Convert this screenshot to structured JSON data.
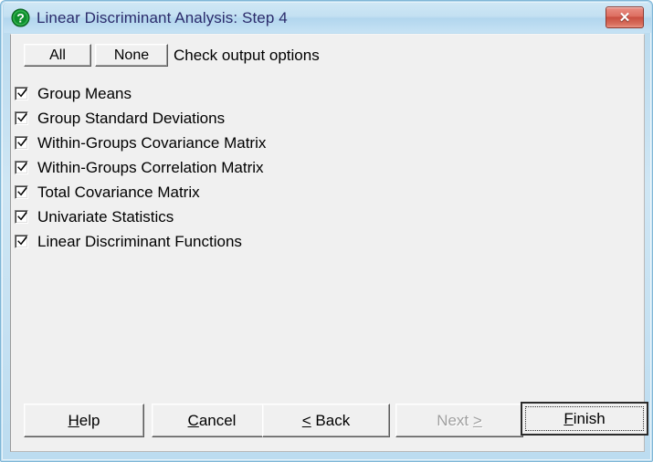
{
  "window": {
    "title": "Linear Discriminant Analysis: Step 4",
    "title_icon": "question-mark-icon",
    "close_label": "✕",
    "accent_title_color": "#2b2b6b",
    "close_button_color": "#c94e40",
    "frame_color": "#7fb6d6",
    "client_background": "#f0f0f0"
  },
  "toolbar": {
    "all_label": "All",
    "none_label": "None",
    "instruction": "Check output options"
  },
  "options": [
    {
      "label": "Group Means",
      "checked": true
    },
    {
      "label": "Group Standard Deviations",
      "checked": true
    },
    {
      "label": "Within-Groups Covariance Matrix",
      "checked": true
    },
    {
      "label": "Within-Groups Correlation Matrix",
      "checked": true
    },
    {
      "label": "Total Covariance Matrix",
      "checked": true
    },
    {
      "label": "Univariate Statistics",
      "checked": true
    },
    {
      "label": "Linear Discriminant Functions",
      "checked": true
    }
  ],
  "footer": {
    "help": {
      "pre": "",
      "accel": "H",
      "post": "elp",
      "disabled": false
    },
    "cancel": {
      "pre": "",
      "accel": "C",
      "post": "ancel",
      "disabled": false
    },
    "back": {
      "pre": "",
      "accel": "<",
      "post": " Back",
      "disabled": false
    },
    "next": {
      "pre": "Next ",
      "accel": ">",
      "post": "",
      "disabled": true
    },
    "finish": {
      "pre": "",
      "accel": "F",
      "post": "inish",
      "disabled": false,
      "is_default": true
    }
  }
}
